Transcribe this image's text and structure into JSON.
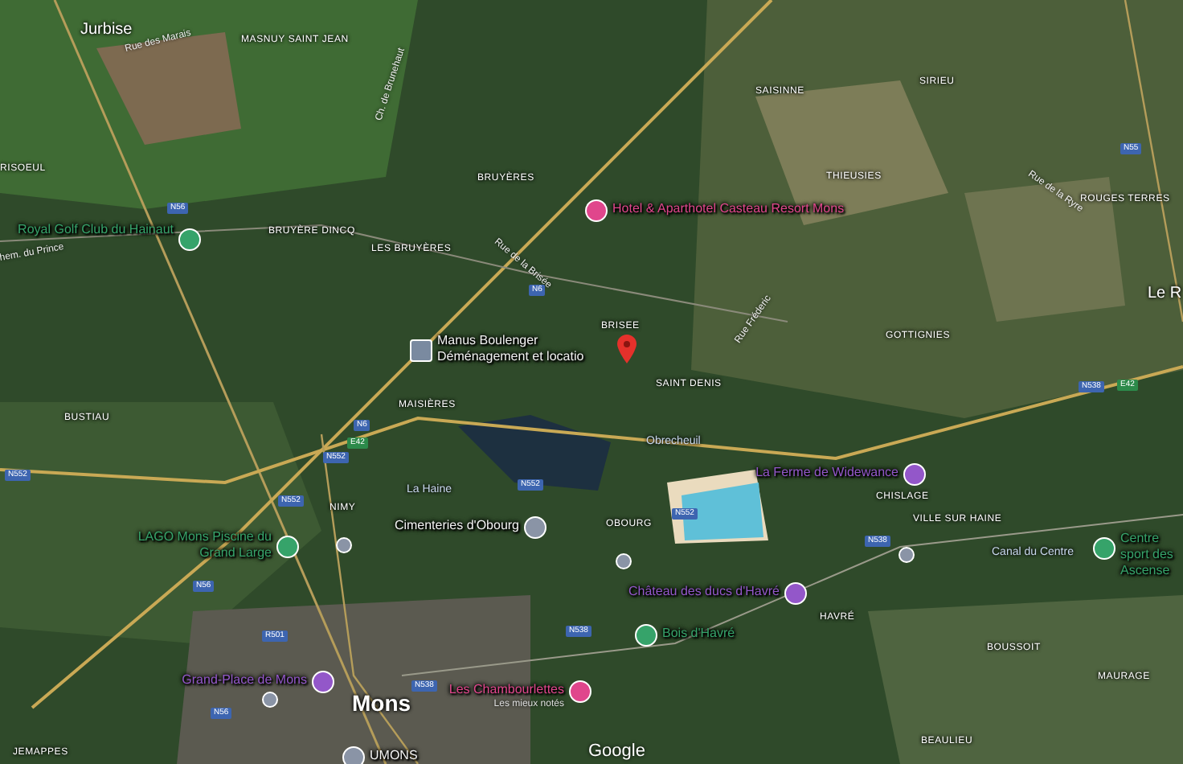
{
  "map": {
    "places": [
      {
        "name": "Jurbise",
        "kind": "town"
      },
      {
        "name": "MASNUY SAINT JEAN",
        "kind": "village"
      },
      {
        "name": "RISOEUL",
        "kind": "village"
      },
      {
        "name": "BRUYÈRES",
        "kind": "village"
      },
      {
        "name": "BRUYÈRE DINCQ",
        "kind": "village"
      },
      {
        "name": "LES BRUYÈRES",
        "kind": "village"
      },
      {
        "name": "SAISINNE",
        "kind": "village"
      },
      {
        "name": "SIRIEU",
        "kind": "village"
      },
      {
        "name": "THIEUSIES",
        "kind": "village"
      },
      {
        "name": "ROUGES TERRES",
        "kind": "village"
      },
      {
        "name": "Le R",
        "kind": "town"
      },
      {
        "name": "BRISEE",
        "kind": "village"
      },
      {
        "name": "GOTTIGNIES",
        "kind": "village"
      },
      {
        "name": "SAINT DENIS",
        "kind": "village"
      },
      {
        "name": "MAISIÈRES",
        "kind": "village"
      },
      {
        "name": "BUSTIAU",
        "kind": "village"
      },
      {
        "name": "NIMY",
        "kind": "village"
      },
      {
        "name": "La Haine",
        "kind": "water"
      },
      {
        "name": "Obrecheuil",
        "kind": "water"
      },
      {
        "name": "OBOURG",
        "kind": "village"
      },
      {
        "name": "CHISLAGE",
        "kind": "village"
      },
      {
        "name": "VILLE SUR HAINE",
        "kind": "village"
      },
      {
        "name": "Canal du Centre",
        "kind": "water"
      },
      {
        "name": "HAVRÉ",
        "kind": "village"
      },
      {
        "name": "BOUSSOIT",
        "kind": "village"
      },
      {
        "name": "MAURAGE",
        "kind": "village"
      },
      {
        "name": "BEAULIEU",
        "kind": "village"
      },
      {
        "name": "JEMAPPES",
        "kind": "village"
      },
      {
        "name": "Mons",
        "kind": "city"
      }
    ],
    "streets": [
      {
        "name": "Rue des Marais"
      },
      {
        "name": "hem. du Prince"
      },
      {
        "name": "Ch. de Brunehaut"
      },
      {
        "name": "Rue de la Brisée"
      },
      {
        "name": "Rue Fréderic"
      },
      {
        "name": "Rue de la Ryre"
      }
    ],
    "roads": [
      {
        "label": "N56"
      },
      {
        "label": "N6"
      },
      {
        "label": "N55"
      },
      {
        "label": "N538"
      },
      {
        "label": "E42"
      },
      {
        "label": "N552"
      },
      {
        "label": "N6"
      },
      {
        "label": "N552"
      },
      {
        "label": "N552"
      },
      {
        "label": "N552"
      },
      {
        "label": "N56"
      },
      {
        "label": "R501"
      },
      {
        "label": "N538"
      },
      {
        "label": "N552"
      },
      {
        "label": "N538"
      },
      {
        "label": "E42"
      },
      {
        "label": "N538"
      },
      {
        "label": "N56"
      }
    ],
    "pois": [
      {
        "name": "Royal Golf Club du Hainaut",
        "kind": "park"
      },
      {
        "name": "Hotel & Aparthotel Casteau Resort Mons",
        "kind": "hotel"
      },
      {
        "name": "Manus Boulenger Déménagement et locatio",
        "kind": "business"
      },
      {
        "name": "LAGO Mons Piscine du Grand Large",
        "kind": "park"
      },
      {
        "name": "Cimenteries d'Obourg",
        "kind": "place"
      },
      {
        "name": "La Ferme de Widewance",
        "kind": "sight"
      },
      {
        "name": "Centre sport des Ascense",
        "kind": "park"
      },
      {
        "name": "Château des ducs d'Havré",
        "kind": "sight"
      },
      {
        "name": "Bois d'Havré",
        "kind": "park"
      },
      {
        "name": "Grand-Place de Mons",
        "kind": "sight"
      },
      {
        "name": "Les Chambourlettes",
        "kind": "hotel",
        "note": "Les mieux notés"
      },
      {
        "name": "UMONS",
        "kind": "place"
      }
    ],
    "logo": "Google"
  }
}
